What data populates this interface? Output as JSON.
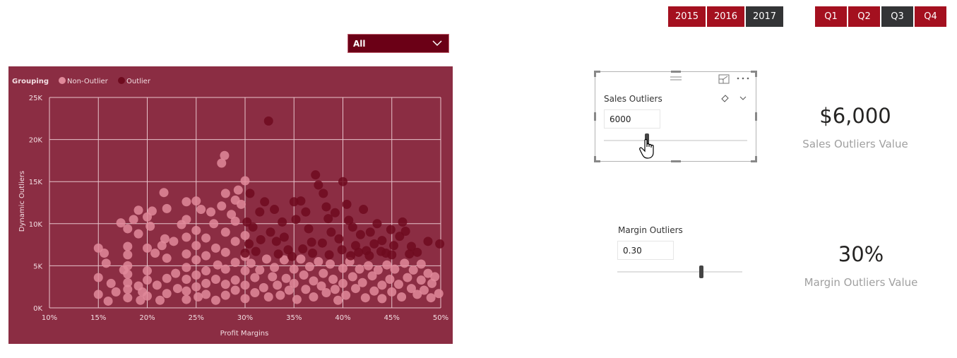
{
  "year_slicer": {
    "items": [
      {
        "label": "2015",
        "selected": false
      },
      {
        "label": "2016",
        "selected": false
      },
      {
        "label": "2017",
        "selected": true
      }
    ]
  },
  "quarter_slicer": {
    "items": [
      {
        "label": "Q1",
        "selected": false
      },
      {
        "label": "Q2",
        "selected": false
      },
      {
        "label": "Q3",
        "selected": true
      },
      {
        "label": "Q4",
        "selected": false
      }
    ]
  },
  "dropdown": {
    "value": "All"
  },
  "colors": {
    "accent_red": "#a4101f",
    "selected_dark": "#333436",
    "chart_bg": "#8b2d43",
    "non_outlier": "#e0899a",
    "outlier": "#6e0a1e"
  },
  "sales_slicer": {
    "title": "Sales Outliers",
    "value": "6000",
    "position_fraction": 0.3
  },
  "margin_slicer": {
    "title": "Margin Outliers",
    "value": "0.30",
    "position_fraction": 0.67
  },
  "kpis": {
    "sales": {
      "value": "$6,000",
      "label": "Sales Outliers Value"
    },
    "margin": {
      "value": "30%",
      "label": "Margin Outliers Value"
    }
  },
  "chart_data": {
    "type": "scatter",
    "title": "",
    "legend": {
      "title": "Grouping",
      "entries": [
        "Non-Outlier",
        "Outlier"
      ],
      "placement": "top-left"
    },
    "xlabel": "Profit Margins",
    "ylabel": "Dynamic Outliers",
    "xlim": [
      10,
      50
    ],
    "ylim": [
      0,
      25000
    ],
    "xticks": [
      "10%",
      "15%",
      "20%",
      "25%",
      "30%",
      "35%",
      "40%",
      "45%",
      "50%"
    ],
    "yticks": [
      "0K",
      "5K",
      "10K",
      "15K",
      "20K",
      "25K"
    ],
    "grid": true,
    "series": [
      {
        "name": "Non-Outlier",
        "points": [
          [
            15.0,
            7100
          ],
          [
            15.0,
            3600
          ],
          [
            15.0,
            1600
          ],
          [
            15.6,
            6500
          ],
          [
            15.8,
            5300
          ],
          [
            16.3,
            2900
          ],
          [
            16.0,
            800
          ],
          [
            16.8,
            1900
          ],
          [
            17.3,
            10100
          ],
          [
            17.6,
            4500
          ],
          [
            18.0,
            9400
          ],
          [
            18.0,
            7300
          ],
          [
            18.0,
            6300
          ],
          [
            18.0,
            5000
          ],
          [
            18.0,
            4000
          ],
          [
            18.0,
            3000
          ],
          [
            18.0,
            2200
          ],
          [
            18.0,
            1200
          ],
          [
            18.6,
            10500
          ],
          [
            19.1,
            11600
          ],
          [
            19.1,
            8800
          ],
          [
            19.1,
            2600
          ],
          [
            19.5,
            1900
          ],
          [
            19.3,
            900
          ],
          [
            20.0,
            10800
          ],
          [
            20.0,
            7100
          ],
          [
            20.0,
            4400
          ],
          [
            20.0,
            3300
          ],
          [
            20.0,
            1400
          ],
          [
            20.5,
            11500
          ],
          [
            20.3,
            9700
          ],
          [
            20.8,
            6500
          ],
          [
            21.0,
            2700
          ],
          [
            21.3,
            900
          ],
          [
            21.5,
            7400
          ],
          [
            21.7,
            13700
          ],
          [
            21.8,
            8200
          ],
          [
            22.0,
            11800
          ],
          [
            22.0,
            5900
          ],
          [
            22.0,
            3500
          ],
          [
            22.0,
            1700
          ],
          [
            22.7,
            7900
          ],
          [
            22.9,
            4100
          ],
          [
            23.1,
            2300
          ],
          [
            23.5,
            9900
          ],
          [
            24.0,
            12600
          ],
          [
            24.0,
            10500
          ],
          [
            24.0,
            8400
          ],
          [
            24.0,
            6400
          ],
          [
            24.0,
            4800
          ],
          [
            24.0,
            3400
          ],
          [
            24.0,
            2000
          ],
          [
            24.0,
            1000
          ],
          [
            25.0,
            12700
          ],
          [
            25.0,
            9200
          ],
          [
            25.0,
            7400
          ],
          [
            25.0,
            5700
          ],
          [
            25.0,
            3900
          ],
          [
            25.0,
            2500
          ],
          [
            25.2,
            1300
          ],
          [
            25.5,
            11700
          ],
          [
            26.0,
            8300
          ],
          [
            26.0,
            6200
          ],
          [
            26.0,
            4400
          ],
          [
            26.0,
            2900
          ],
          [
            26.0,
            1600
          ],
          [
            26.5,
            11400
          ],
          [
            26.8,
            10000
          ],
          [
            27.0,
            7100
          ],
          [
            27.2,
            5100
          ],
          [
            27.0,
            3400
          ],
          [
            27.0,
            900
          ],
          [
            27.6,
            12100
          ],
          [
            27.6,
            17200
          ],
          [
            27.9,
            18100
          ],
          [
            28.0,
            13600
          ],
          [
            28.0,
            9000
          ],
          [
            28.0,
            6600
          ],
          [
            28.0,
            4600
          ],
          [
            28.0,
            2800
          ],
          [
            28.0,
            1500
          ],
          [
            28.6,
            11100
          ],
          [
            29.0,
            12800
          ],
          [
            29.0,
            10300
          ],
          [
            29.0,
            7900
          ],
          [
            29.0,
            5400
          ],
          [
            29.0,
            3300
          ],
          [
            29.0,
            2100
          ],
          [
            29.3,
            14000
          ],
          [
            29.6,
            12300
          ],
          [
            30.0,
            15100
          ],
          [
            30.0,
            8600
          ],
          [
            30.0,
            6100
          ],
          [
            30.0,
            4400
          ],
          [
            30.0,
            2700
          ],
          [
            30.0,
            1100
          ],
          [
            30.6,
            5300
          ],
          [
            31.0,
            3600
          ],
          [
            31.0,
            1800
          ],
          [
            31.5,
            4500
          ],
          [
            31.9,
            2400
          ],
          [
            32.2,
            5800
          ],
          [
            32.4,
            1300
          ],
          [
            32.8,
            3700
          ],
          [
            33.0,
            4800
          ],
          [
            33.3,
            2700
          ],
          [
            33.6,
            1500
          ],
          [
            34.0,
            5700
          ],
          [
            34.2,
            3500
          ],
          [
            34.5,
            2100
          ],
          [
            35.0,
            4600
          ],
          [
            35.0,
            2900
          ],
          [
            35.3,
            1000
          ],
          [
            35.7,
            5800
          ],
          [
            36.0,
            3900
          ],
          [
            36.2,
            2200
          ],
          [
            36.6,
            4900
          ],
          [
            37.0,
            3200
          ],
          [
            37.0,
            1300
          ],
          [
            37.5,
            5500
          ],
          [
            37.8,
            2600
          ],
          [
            38.0,
            4100
          ],
          [
            38.3,
            1800
          ],
          [
            38.7,
            5200
          ],
          [
            39.0,
            3400
          ],
          [
            39.2,
            2200
          ],
          [
            39.5,
            900
          ],
          [
            40.0,
            4700
          ],
          [
            40.0,
            2900
          ],
          [
            40.3,
            1500
          ],
          [
            40.7,
            5500
          ],
          [
            41.0,
            3700
          ],
          [
            41.3,
            2300
          ],
          [
            41.7,
            4600
          ],
          [
            42.0,
            3000
          ],
          [
            42.3,
            1200
          ],
          [
            42.6,
            5000
          ],
          [
            43.0,
            3800
          ],
          [
            43.2,
            2000
          ],
          [
            43.6,
            4500
          ],
          [
            44.0,
            2700
          ],
          [
            44.0,
            1100
          ],
          [
            44.5,
            5100
          ],
          [
            44.8,
            3400
          ],
          [
            45.0,
            1900
          ],
          [
            45.3,
            4600
          ],
          [
            45.7,
            2800
          ],
          [
            46.0,
            1300
          ],
          [
            46.3,
            5300
          ],
          [
            46.6,
            3600
          ],
          [
            47.0,
            2300
          ],
          [
            47.2,
            4500
          ],
          [
            47.6,
            1600
          ],
          [
            48.0,
            5200
          ],
          [
            48.0,
            3300
          ],
          [
            48.3,
            2100
          ],
          [
            48.7,
            4100
          ],
          [
            49.0,
            1200
          ],
          [
            49.1,
            2900
          ],
          [
            49.4,
            3700
          ],
          [
            49.8,
            1700
          ]
        ]
      },
      {
        "name": "Outlier",
        "points": [
          [
            32.4,
            22200
          ],
          [
            32.0,
            12600
          ],
          [
            33.0,
            11700
          ],
          [
            30.5,
            13600
          ],
          [
            31.5,
            11400
          ],
          [
            30.2,
            10200
          ],
          [
            30.8,
            9600
          ],
          [
            30.4,
            7600
          ],
          [
            30.0,
            6500
          ],
          [
            31.1,
            6700
          ],
          [
            31.6,
            8100
          ],
          [
            32.6,
            9000
          ],
          [
            33.2,
            7900
          ],
          [
            33.8,
            10200
          ],
          [
            34.0,
            8400
          ],
          [
            34.4,
            6900
          ],
          [
            35.0,
            12600
          ],
          [
            35.2,
            10500
          ],
          [
            35.7,
            12700
          ],
          [
            36.2,
            11400
          ],
          [
            36.5,
            9400
          ],
          [
            36.8,
            7800
          ],
          [
            37.2,
            15800
          ],
          [
            37.5,
            14600
          ],
          [
            38.0,
            13600
          ],
          [
            38.3,
            12000
          ],
          [
            38.5,
            10600
          ],
          [
            38.8,
            9000
          ],
          [
            39.2,
            11300
          ],
          [
            39.6,
            8200
          ],
          [
            40.0,
            15000
          ],
          [
            40.4,
            12300
          ],
          [
            40.6,
            10400
          ],
          [
            41.0,
            9600
          ],
          [
            41.3,
            7400
          ],
          [
            41.8,
            8700
          ],
          [
            42.1,
            11700
          ],
          [
            42.4,
            6800
          ],
          [
            42.8,
            9000
          ],
          [
            43.2,
            7600
          ],
          [
            43.5,
            10000
          ],
          [
            44.0,
            8000
          ],
          [
            44.4,
            6500
          ],
          [
            44.9,
            9300
          ],
          [
            45.2,
            7400
          ],
          [
            45.8,
            8500
          ],
          [
            46.1,
            10200
          ],
          [
            46.4,
            9100
          ],
          [
            47.0,
            7300
          ],
          [
            47.6,
            6600
          ],
          [
            48.7,
            7900
          ],
          [
            49.9,
            7600
          ],
          [
            33.4,
            6400
          ],
          [
            34.8,
            6100
          ],
          [
            35.9,
            7000
          ],
          [
            36.9,
            6500
          ],
          [
            37.9,
            7700
          ],
          [
            38.6,
            6300
          ],
          [
            39.9,
            6900
          ],
          [
            40.8,
            6200
          ],
          [
            41.6,
            6600
          ],
          [
            42.7,
            6200
          ],
          [
            43.9,
            6700
          ],
          [
            45.0,
            6300
          ],
          [
            46.8,
            6400
          ]
        ]
      }
    ]
  }
}
